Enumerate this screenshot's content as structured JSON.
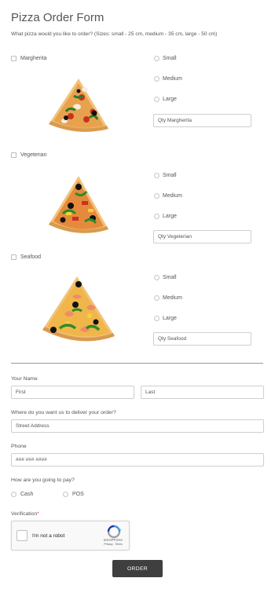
{
  "form": {
    "title": "Pizza Order Form",
    "subtitle": "What pizza would you like to order? (Sizes: small - 25 cm, medium - 35 cm, large - 50 cm)"
  },
  "pizzas": [
    {
      "label": "Margherita",
      "sizes": [
        "Small",
        "Medium",
        "Large"
      ],
      "qty_placeholder": "Qty Margherita"
    },
    {
      "label": "Vegeterian",
      "sizes": [
        "Small",
        "Medium",
        "Large"
      ],
      "qty_placeholder": "Qty Vegeterian"
    },
    {
      "label": "Seafood",
      "sizes": [
        "Small",
        "Medium",
        "Large"
      ],
      "qty_placeholder": "Qty Seafood"
    }
  ],
  "name": {
    "label": "Your Name",
    "first_placeholder": "First",
    "last_placeholder": "Last"
  },
  "address": {
    "label": "Where do you want us to deliver your order?",
    "placeholder": "Street Address"
  },
  "phone": {
    "label": "Phone",
    "placeholder": "### ### ####"
  },
  "payment": {
    "label": "How are you going to pay?",
    "options": [
      "Cash",
      "POS"
    ]
  },
  "verification": {
    "label": "Verification",
    "required_mark": "*",
    "captcha_text": "I'm not a robot",
    "captcha_brand": "reCAPTCHA",
    "captcha_links": "Privacy - Terms"
  },
  "submit": {
    "label": "ORDER"
  },
  "colors": {
    "accent": "#3f3f3f",
    "required": "#e0413f",
    "border": "#cfcfcf"
  },
  "icons": [
    "pizza-slice-image",
    "recaptcha-icon"
  ]
}
